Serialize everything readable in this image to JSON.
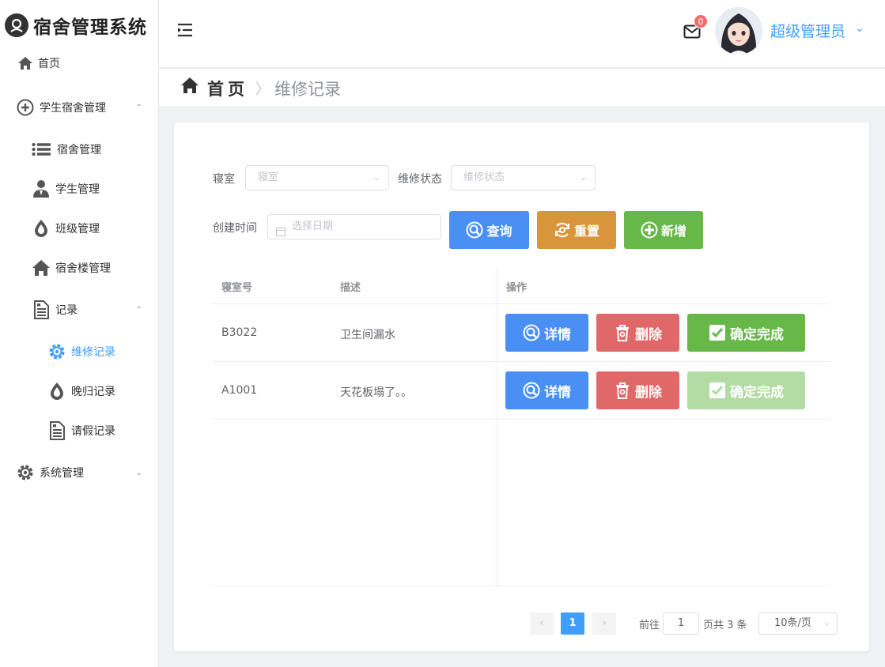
{
  "app": {
    "title": "宿舍管理系统"
  },
  "sidebar": {
    "items": [
      {
        "label": "首页"
      },
      {
        "label": "学生宿舍管理",
        "arrow": "⌃"
      },
      {
        "label": "宿舍管理"
      },
      {
        "label": "学生管理"
      },
      {
        "label": "班级管理"
      },
      {
        "label": "宿舍楼管理"
      },
      {
        "label": "记录",
        "arrow": "⌃"
      },
      {
        "label": "维修记录",
        "active": true
      },
      {
        "label": "晚归记录"
      },
      {
        "label": "请假记录"
      },
      {
        "label": "系统管理",
        "arrow": "⌄"
      }
    ]
  },
  "header": {
    "notification_count": "0",
    "user_name": "超级管理员",
    "user_caret": "⌄"
  },
  "breadcrumb": {
    "home": "首页",
    "separator": "〉",
    "current": "维修记录"
  },
  "filters": {
    "room_label": "寝室",
    "room_placeholder": "寝室",
    "status_label": "维修状态",
    "status_placeholder": "维修状态",
    "date_label": "创建时间",
    "date_placeholder": "选择日期",
    "query_button": "查询",
    "reset_button": "重置",
    "add_button": "新增"
  },
  "table": {
    "headers": [
      "寝室号",
      "描述",
      "操作"
    ],
    "rows": [
      {
        "room": "B3022",
        "desc": "卫生间漏水",
        "detail": "详情",
        "delete": "删除",
        "complete": "确定完成",
        "complete_disabled": false
      },
      {
        "room": "A1001",
        "desc": "天花板塌了。。",
        "detail": "详情",
        "delete": "删除",
        "complete": "确定完成",
        "complete_disabled": true
      }
    ]
  },
  "pagination": {
    "prev": "‹",
    "current_page": "1",
    "next": "›",
    "goto_label": "前往",
    "goto_value": "1",
    "total_text": "页共 3 条",
    "page_size": "10条/页"
  },
  "colors": {
    "primary": "#409eff",
    "query": "#4a8ff4",
    "reset": "#d9953c",
    "add": "#67b848",
    "delete": "#e06868",
    "complete": "#67b848",
    "complete_disabled": "#b3dca4",
    "badge": "#f56c6c"
  }
}
